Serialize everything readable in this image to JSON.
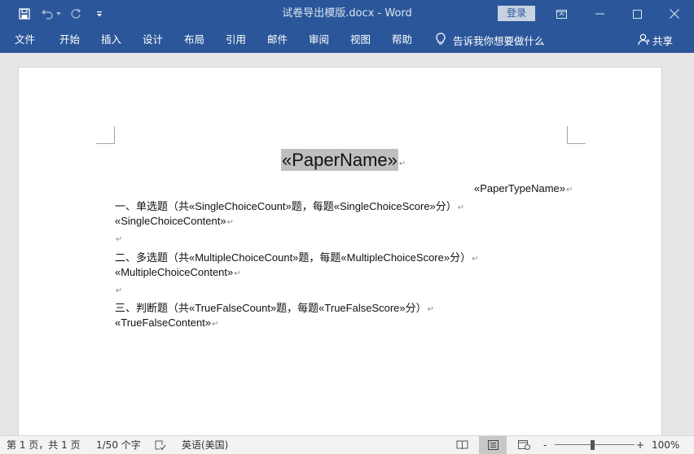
{
  "window": {
    "title": "试卷导出模版.docx  -  Word",
    "login_label": "登录"
  },
  "ribbon": {
    "tabs": [
      "文件",
      "开始",
      "插入",
      "设计",
      "布局",
      "引用",
      "邮件",
      "审阅",
      "视图",
      "帮助"
    ],
    "tell_me": "告诉我你想要做什么",
    "share": "共享"
  },
  "document": {
    "paper_name": "«PaperName»",
    "paper_type": "«PaperTypeName»",
    "lines": [
      "一、单选题（共«SingleChoiceCount»题，每题«SingleChoiceScore»分）",
      "«SingleChoiceContent»",
      "",
      "二、多选题（共«MultipleChoiceCount»题，每题«MultipleChoiceScore»分）",
      "«MultipleChoiceContent»",
      "",
      "三、判断题（共«TrueFalseCount»题，每题«TrueFalseScore»分）",
      "«TrueFalseContent»"
    ],
    "paragraph_mark": "↵"
  },
  "statusbar": {
    "page": "第 1 页，共 1 页",
    "words": "1/50 个字",
    "language": "英语(美国)",
    "zoom": "100%",
    "zoom_minus": "-",
    "zoom_plus": "+"
  },
  "colors": {
    "title_bar": "#2b579a",
    "highlight": "#bfbfbf"
  },
  "icons": {
    "save": "save-icon",
    "undo": "undo-icon",
    "redo": "redo-icon",
    "customize": "customize-toolbar-icon",
    "ribbon_display": "ribbon-display-options-icon",
    "minimize": "minimize-icon",
    "maximize": "maximize-icon",
    "close": "close-icon",
    "lightbulb": "lightbulb-icon",
    "share": "person-icon"
  }
}
